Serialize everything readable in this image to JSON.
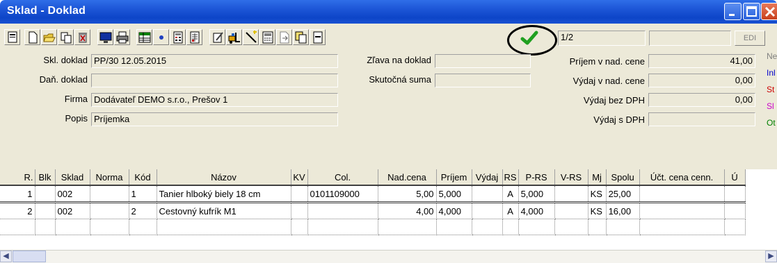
{
  "window": {
    "title": "Sklad - Doklad"
  },
  "toolbar": {
    "counter": "1/2",
    "blank": "",
    "edi_label": "EDI",
    "buttons": [
      "new-doc-icon",
      "new-icon",
      "open-icon",
      "copy-icon",
      "delete-icon",
      "monitor-icon",
      "print-icon",
      "table-icon",
      "dot-icon",
      "calc-icon",
      "grid-icon",
      "edit-icon",
      "forklift-icon",
      "wand-icon",
      "keyboard-icon",
      "doc-arrow-icon",
      "copy2-icon",
      "page-icon"
    ],
    "confirm_icon": "check-icon"
  },
  "form": {
    "skl_doklad_label": "Skl. doklad",
    "skl_doklad_value": "PP/30 12.05.2015",
    "dan_doklad_label": "Daň. doklad",
    "dan_doklad_value": "",
    "firma_label": "Firma",
    "firma_value": "Dodávateľ DEMO s.r.o., Prešov 1",
    "popis_label": "Popis",
    "popis_value": "Príjemka",
    "zlava_label": "Zľava na doklad",
    "zlava_value": "",
    "skutocna_label": "Skutočná suma",
    "skutocna_value": "",
    "prijem_label": "Príjem v nad. cene",
    "prijem_value": "41,00",
    "vydaj_label": "Výdaj v nad. cene",
    "vydaj_value": "0,00",
    "vydaj_bez_label": "Výdaj bez DPH",
    "vydaj_bez_value": "0,00",
    "vydaj_s_label": "Výdaj s DPH",
    "vydaj_s_value": ""
  },
  "legend": [
    {
      "text": "Ne",
      "color": "#808080"
    },
    {
      "text": "Inl",
      "color": "#0000cc"
    },
    {
      "text": "St",
      "color": "#cc0000"
    },
    {
      "text": "Sl",
      "color": "#cc00cc"
    },
    {
      "text": "Ot",
      "color": "#008000"
    }
  ],
  "grid": {
    "columns": [
      "R.",
      "Blk",
      "Sklad",
      "Norma",
      "Kód",
      "Názov",
      "KV",
      "Col.",
      "Nad.cena",
      "Príjem",
      "Výdaj",
      "RS",
      "P-RS",
      "V-RS",
      "Mj",
      "Spolu",
      "Účt. cena cenn.",
      "Ú"
    ],
    "rows": [
      [
        "1",
        "",
        "002",
        "",
        "1",
        "Tanier hlboký biely 18 cm",
        "",
        "0101109000",
        "5,00",
        "5,000",
        "",
        "A",
        "5,000",
        "",
        "KS",
        "25,00",
        "",
        ""
      ],
      [
        "2",
        "",
        "002",
        "",
        "2",
        "Cestovný kufrík M1",
        "",
        "",
        "4,00",
        "4,000",
        "",
        "A",
        "4,000",
        "",
        "KS",
        "16,00",
        "",
        ""
      ],
      [
        "",
        "",
        "",
        "",
        "",
        "",
        "",
        "",
        "",
        "",
        "",
        "",
        "",
        "",
        "",
        "",
        "",
        ""
      ]
    ]
  }
}
